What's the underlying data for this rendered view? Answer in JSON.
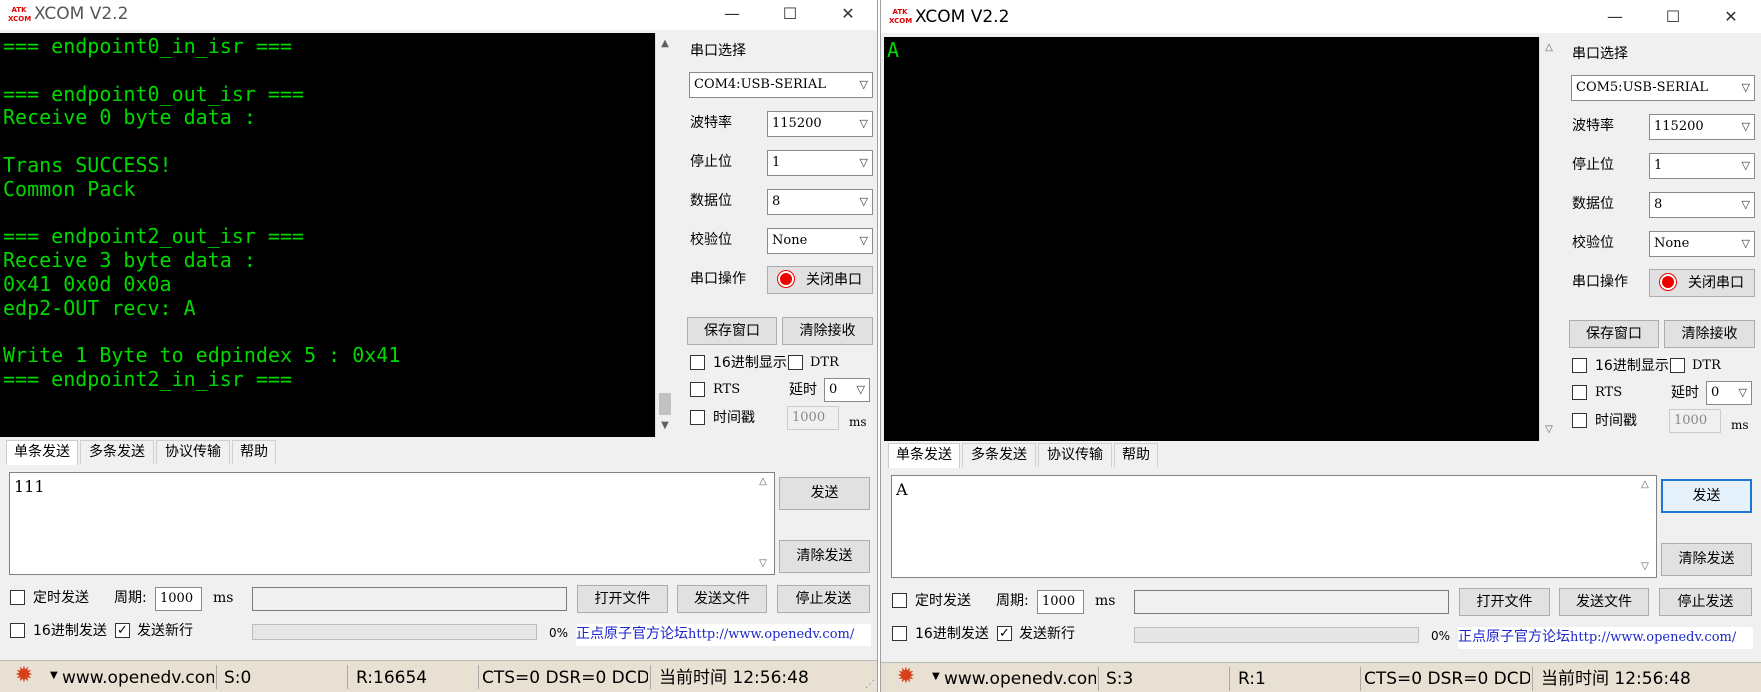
{
  "window_title": "XCOM V2.2",
  "logo_text": "ATK XCOM",
  "window_controls": {
    "minimize": "—",
    "maximize": "☐",
    "close": "✕"
  },
  "left": {
    "receive_text": "=== endpoint0_in_isr ===\n\n=== endpoint0_out_isr ===\nReceive 0 byte data :\n\nTrans SUCCESS!\nCommon Pack\n\n=== endpoint2_out_isr ===\nReceive 3 byte data :\n0x41 0x0d 0x0a\nedp2-OUT recv: A\n\nWrite 1 Byte to edpindex 5 : 0x41\n=== endpoint2_in_isr ===",
    "port_label": "串口选择",
    "port_value": "COM4:USB-SERIAL",
    "baud_label": "波特率",
    "baud_value": "115200",
    "stop_label": "停止位",
    "stop_value": "1",
    "data_label": "数据位",
    "data_value": "8",
    "parity_label": "校验位",
    "parity_value": "None",
    "op_label": "串口操作",
    "op_button": "关闭串口",
    "save_window": "保存窗口",
    "clear_receive": "清除接收",
    "hex_display": "16进制显示",
    "dtr": "DTR",
    "rts": "RTS",
    "delay_label": "延时",
    "delay_value": "0",
    "timestamp": "时间戳",
    "timestamp_value": "1000",
    "ms": "ms",
    "tabs": [
      "单条发送",
      "多条发送",
      "协议传输",
      "帮助"
    ],
    "send_text": "111",
    "send_button": "发送",
    "clear_send": "清除发送",
    "timed_send": "定时发送",
    "period_label": "周期:",
    "period_value": "1000",
    "period_unit": "ms",
    "open_file": "打开文件",
    "send_file": "发送文件",
    "stop_send": "停止发送",
    "hex_send": "16进制发送",
    "send_newline": "发送新行",
    "send_newline_checked": true,
    "progress": "0%",
    "forum_text": "正点原子官方论坛",
    "forum_url": "http://www.openedv.com/",
    "status_site": "www.openedv.com",
    "status_s": "S:0",
    "status_r": "R:16654",
    "status_lines": "CTS=0 DSR=0 DCD=0",
    "status_time": "当前时间 12:56:48"
  },
  "right": {
    "receive_text": "A",
    "port_label": "串口选择",
    "port_value": "COM5:USB-SERIAL",
    "baud_label": "波特率",
    "baud_value": "115200",
    "stop_label": "停止位",
    "stop_value": "1",
    "data_label": "数据位",
    "data_value": "8",
    "parity_label": "校验位",
    "parity_value": "None",
    "op_label": "串口操作",
    "op_button": "关闭串口",
    "save_window": "保存窗口",
    "clear_receive": "清除接收",
    "hex_display": "16进制显示",
    "dtr": "DTR",
    "rts": "RTS",
    "delay_label": "延时",
    "delay_value": "0",
    "timestamp": "时间戳",
    "timestamp_value": "1000",
    "ms": "ms",
    "tabs": [
      "单条发送",
      "多条发送",
      "协议传输",
      "帮助"
    ],
    "send_text": "A",
    "send_button": "发送",
    "clear_send": "清除发送",
    "timed_send": "定时发送",
    "period_label": "周期:",
    "period_value": "1000",
    "period_unit": "ms",
    "open_file": "打开文件",
    "send_file": "发送文件",
    "stop_send": "停止发送",
    "hex_send": "16进制发送",
    "send_newline": "发送新行",
    "send_newline_checked": true,
    "progress": "0%",
    "forum_text": "正点原子官方论坛",
    "forum_url": "http://www.openedv.com/",
    "status_site": "www.openedv.com",
    "status_s": "S:3",
    "status_r": "R:1",
    "status_lines": "CTS=0 DSR=0 DCD=0",
    "status_time": "当前时间 12:56:48"
  }
}
